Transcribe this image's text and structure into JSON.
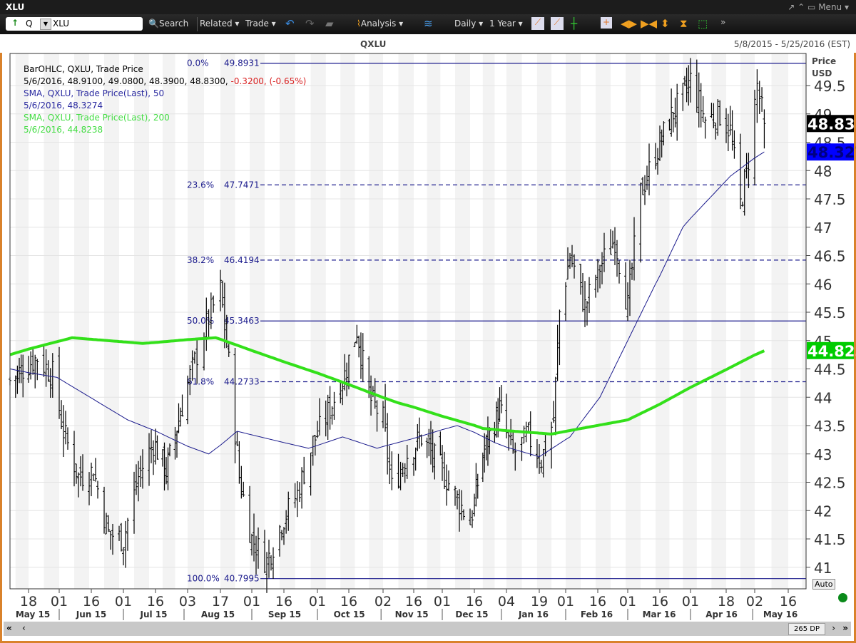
{
  "window": {
    "title": "XLU",
    "menu_label": "Menu",
    "controls": [
      "↗",
      "⌃",
      "▭"
    ]
  },
  "toolbar": {
    "symbol_prefix": "Q",
    "symbol_value": "XLU",
    "search_label": "Search",
    "related_label": "Related ▾",
    "trade_label": "Trade ▾",
    "analysis_label": "Analysis ▾",
    "period_label": "Daily ▾",
    "range_label": "1 Year ▾"
  },
  "chart_header": {
    "symbol": "QXLU",
    "date_range": "5/8/2015 - 5/25/2016 (EST)"
  },
  "legend": {
    "line1": "BarOHLC, QXLU, Trade Price",
    "line2_values": "5/6/2016, 48.9100, 49.0800, 48.3900, 48.8300, ",
    "line2_change": "-0.3200, (-0.65%)",
    "sma50_label": "SMA, QXLU, Trade Price(Last),  50",
    "sma50_value": "5/6/2016, 48.3274",
    "sma200_label": "SMA, QXLU, Trade Price(Last),  200",
    "sma200_value": "5/6/2016, 44.8238"
  },
  "axis": {
    "price_label": "Price",
    "currency": "USD",
    "auto_label": "Auto",
    "data_points": "265 DP"
  },
  "colors": {
    "bars": "#000000",
    "sma50": "#1a1a8c",
    "sma200": "#33e01a",
    "fib": "#1a1a8c",
    "change_negative": "#d92020",
    "band": "#f2f2f2",
    "frame": "#d9822b"
  },
  "chart_data": {
    "type": "bar-ohlc",
    "ylim": [
      40.7,
      50.1
    ],
    "yticks": [
      "41",
      "41.5",
      "42",
      "42.5",
      "43",
      "43.5",
      "44",
      "44.5",
      "45",
      "45.5",
      "46",
      "46.5",
      "47",
      "47.5",
      "48",
      "48.5",
      "49",
      "49.5"
    ],
    "last_bar": {
      "date": "2016-05-06",
      "open": 48.91,
      "high": 49.08,
      "low": 48.39,
      "close": 48.83
    },
    "price_flags": [
      {
        "label": "48.83",
        "value": 48.83,
        "color": "#000000"
      },
      {
        "label": "48.327",
        "value": 48.3274,
        "color": "#0000ff"
      },
      {
        "label": "44.823",
        "value": 44.8238,
        "color": "#00cc00"
      }
    ],
    "fibonacci": [
      {
        "pct": "0.0%",
        "value": "49.8931",
        "style": "solid"
      },
      {
        "pct": "23.6%",
        "value": "47.7471",
        "style": "dashed"
      },
      {
        "pct": "38.2%",
        "value": "46.4194",
        "style": "dashed"
      },
      {
        "pct": "50.0%",
        "value": "45.3463",
        "style": "solid"
      },
      {
        "pct": "61.8%",
        "value": "44.2733",
        "style": "dashed"
      },
      {
        "pct": "100.0%",
        "value": "40.7995",
        "style": "solid"
      }
    ],
    "close_path": [
      [
        "2015-05-08",
        44.3
      ],
      [
        "2015-05-15",
        44.5
      ],
      [
        "2015-05-22",
        44.7
      ],
      [
        "2015-05-29",
        44.4
      ],
      [
        "2015-06-03",
        43.4
      ],
      [
        "2015-06-10",
        42.6
      ],
      [
        "2015-06-17",
        42.7
      ],
      [
        "2015-06-24",
        41.6
      ],
      [
        "2015-07-01",
        41.5
      ],
      [
        "2015-07-08",
        42.6
      ],
      [
        "2015-07-15",
        43.2
      ],
      [
        "2015-07-22",
        42.7
      ],
      [
        "2015-07-29",
        43.6
      ],
      [
        "2015-08-05",
        44.5
      ],
      [
        "2015-08-12",
        45.4
      ],
      [
        "2015-08-17",
        45.9
      ],
      [
        "2015-08-21",
        44.6
      ],
      [
        "2015-08-26",
        42.6
      ],
      [
        "2015-09-01",
        41.5
      ],
      [
        "2015-09-08",
        41.1
      ],
      [
        "2015-09-15",
        41.8
      ],
      [
        "2015-09-22",
        42.3
      ],
      [
        "2015-09-29",
        43.2
      ],
      [
        "2015-10-07",
        43.8
      ],
      [
        "2015-10-14",
        44.4
      ],
      [
        "2015-10-20",
        45.2
      ],
      [
        "2015-10-26",
        44.0
      ],
      [
        "2015-11-02",
        43.6
      ],
      [
        "2015-11-06",
        42.4
      ],
      [
        "2015-11-13",
        43.0
      ],
      [
        "2015-11-20",
        43.3
      ],
      [
        "2015-12-01",
        42.7
      ],
      [
        "2015-12-08",
        42.2
      ],
      [
        "2015-12-14",
        41.8
      ],
      [
        "2015-12-21",
        43.0
      ],
      [
        "2015-12-31",
        43.8
      ],
      [
        "2016-01-07",
        43.0
      ],
      [
        "2016-01-14",
        43.3
      ],
      [
        "2016-01-20",
        42.9
      ],
      [
        "2016-01-26",
        43.6
      ],
      [
        "2016-01-29",
        45.5
      ],
      [
        "2016-02-03",
        46.5
      ],
      [
        "2016-02-10",
        45.6
      ],
      [
        "2016-02-17",
        46.3
      ],
      [
        "2016-02-24",
        46.8
      ],
      [
        "2016-03-01",
        45.6
      ],
      [
        "2016-03-07",
        47.6
      ],
      [
        "2016-03-14",
        48.3
      ],
      [
        "2016-03-21",
        48.9
      ],
      [
        "2016-03-28",
        49.3
      ],
      [
        "2016-04-01",
        49.6
      ],
      [
        "2016-04-08",
        48.9
      ],
      [
        "2016-04-15",
        49.0
      ],
      [
        "2016-04-20",
        48.7
      ],
      [
        "2016-04-25",
        47.4
      ],
      [
        "2016-04-29",
        48.2
      ],
      [
        "2016-05-03",
        49.5
      ],
      [
        "2016-05-06",
        48.83
      ]
    ],
    "series": [
      {
        "name": "SMA 50",
        "points": [
          [
            "2015-05-08",
            44.5
          ],
          [
            "2015-05-31",
            44.35
          ],
          [
            "2015-07-03",
            43.6
          ],
          [
            "2015-08-12",
            43.0
          ],
          [
            "2015-08-25",
            43.4
          ],
          [
            "2015-09-27",
            43.1
          ],
          [
            "2015-10-13",
            43.3
          ],
          [
            "2015-10-30",
            43.1
          ],
          [
            "2015-12-08",
            43.5
          ],
          [
            "2015-12-28",
            43.2
          ],
          [
            "2016-01-19",
            42.95
          ],
          [
            "2016-02-03",
            43.3
          ],
          [
            "2016-02-17",
            44.0
          ],
          [
            "2016-03-01",
            45.0
          ],
          [
            "2016-03-14",
            46.0
          ],
          [
            "2016-03-28",
            47.0
          ],
          [
            "2016-04-20",
            47.9
          ],
          [
            "2016-05-06",
            48.33
          ]
        ]
      },
      {
        "name": "SMA 200",
        "points": [
          [
            "2015-05-08",
            44.75
          ],
          [
            "2015-06-07",
            45.05
          ],
          [
            "2015-07-10",
            44.95
          ],
          [
            "2015-08-15",
            45.05
          ],
          [
            "2015-10-03",
            44.4
          ],
          [
            "2015-11-09",
            43.9
          ],
          [
            "2015-12-21",
            43.45
          ],
          [
            "2016-01-25",
            43.35
          ],
          [
            "2016-03-01",
            43.6
          ],
          [
            "2016-03-28",
            44.1
          ],
          [
            "2016-05-06",
            44.82
          ]
        ]
      }
    ],
    "x_ticks": [
      {
        "label": "18",
        "date": "2015-05-18"
      },
      {
        "label": "01",
        "date": "2015-06-01"
      },
      {
        "label": "16",
        "date": "2015-06-16"
      },
      {
        "label": "01",
        "date": "2015-07-01"
      },
      {
        "label": "16",
        "date": "2015-07-16"
      },
      {
        "label": "03",
        "date": "2015-08-03"
      },
      {
        "label": "17",
        "date": "2015-08-17"
      },
      {
        "label": "01",
        "date": "2015-09-01"
      },
      {
        "label": "16",
        "date": "2015-09-16"
      },
      {
        "label": "01",
        "date": "2015-10-01"
      },
      {
        "label": "16",
        "date": "2015-10-16"
      },
      {
        "label": "02",
        "date": "2015-11-02"
      },
      {
        "label": "16",
        "date": "2015-11-16"
      },
      {
        "label": "01",
        "date": "2015-12-01"
      },
      {
        "label": "16",
        "date": "2015-12-16"
      },
      {
        "label": "04",
        "date": "2016-01-04"
      },
      {
        "label": "19",
        "date": "2016-01-19"
      },
      {
        "label": "01",
        "date": "2016-02-01"
      },
      {
        "label": "16",
        "date": "2016-02-16"
      },
      {
        "label": "01",
        "date": "2016-03-01"
      },
      {
        "label": "16",
        "date": "2016-03-16"
      },
      {
        "label": "01",
        "date": "2016-04-01"
      },
      {
        "label": "18",
        "date": "2016-04-18"
      },
      {
        "label": "02",
        "date": "2016-05-02"
      },
      {
        "label": "16",
        "date": "2016-05-16"
      }
    ],
    "months": [
      "May 15",
      "Jun 15",
      "Jul 15",
      "Aug 15",
      "Sep 15",
      "Oct 15",
      "Nov 15",
      "Dec 15",
      "Jan 16",
      "Feb 16",
      "Mar 16",
      "Apr 16",
      "May 16"
    ]
  }
}
